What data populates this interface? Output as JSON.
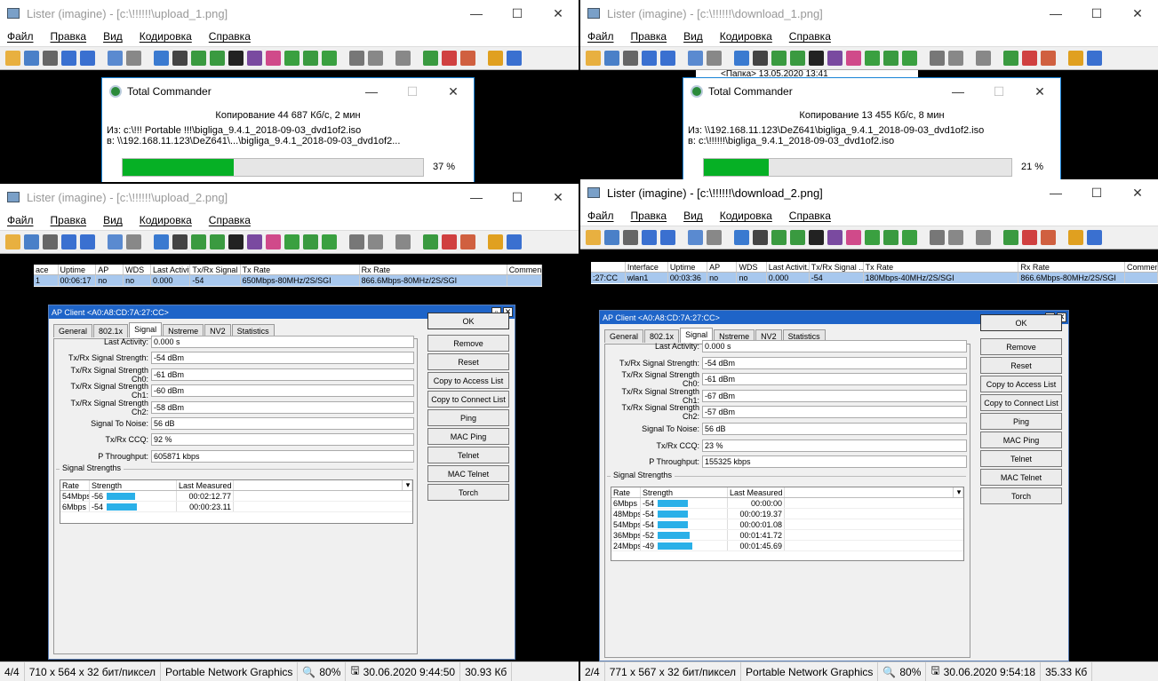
{
  "menu": [
    "Файл",
    "Правка",
    "Вид",
    "Кодировка",
    "Справка"
  ],
  "windows": {
    "w1": {
      "title": "Lister (imagine) - [c:\\!!!!!!\\upload_1.png]"
    },
    "w2": {
      "title": "Lister (imagine) - [c:\\!!!!!!\\download_1.png]"
    },
    "w3": {
      "title": "Lister (imagine) - [c:\\!!!!!!\\upload_2.png]"
    },
    "w4": {
      "title": "Lister (imagine) - [c:\\!!!!!!\\download_2.png]"
    }
  },
  "copy1": {
    "title": "Total Commander",
    "status": "Копирование 44 687 Кб/с, 2 мин",
    "from": "Из:  c:\\!!! Portable !!!\\bigliga_9.4.1_2018-09-03_dvd1of2.iso",
    "to": "в:  \\\\192.168.11.123\\DeZ641\\...\\bigliga_9.4.1_2018-09-03_dvd1of2...",
    "percent_text": "37 %",
    "progress": 0.37
  },
  "copy2": {
    "title": "Total Commander",
    "status": "Копирование 13 455 Кб/с, 8 мин",
    "from": "Из:  \\\\192.168.11.123\\DeZ641\\bigliga_9.4.1_2018-09-03_dvd1of2.iso",
    "to": "в:  c:\\!!!!!!\\bigliga_9.4.1_2018-09-03_dvd1of2.iso",
    "percent_text": "21 %",
    "progress": 0.21,
    "folder_text": "<Папка> 13.05.2020 13:41"
  },
  "table_up": {
    "headers": [
      "ace",
      "Uptime",
      "AP",
      "WDS",
      "Last Activit...",
      "Tx/Rx Signal ...",
      "Tx Rate",
      "Rx Rate",
      "Comment"
    ],
    "row": [
      "1",
      "00:06:17",
      "no",
      "no",
      "0.000",
      "-54",
      "650Mbps-80MHz/2S/SGI",
      "866.6Mbps-80MHz/2S/SGI",
      ""
    ]
  },
  "table_down": {
    "headers": [
      "",
      "Interface",
      "Uptime",
      "AP",
      "WDS",
      "Last Activit...",
      "Tx/Rx Signal ...",
      "Tx Rate",
      "Rx Rate",
      "Comment"
    ],
    "row": [
      ":27:CC",
      "wlan1",
      "00:03:36",
      "no",
      "no",
      "0.000",
      "-54",
      "180Mbps-40MHz/2S/SGI",
      "866.6Mbps-80MHz/2S/SGI",
      ""
    ]
  },
  "dlg_up": {
    "title": "AP Client <A0:A8:CD:7A:27:CC>",
    "tabs": [
      "General",
      "802.1x",
      "Signal",
      "Nstreme",
      "NV2",
      "Statistics"
    ],
    "fields": [
      [
        "Last Activity:",
        "0.000 s"
      ],
      [
        "Tx/Rx Signal Strength:",
        "-54 dBm"
      ],
      [
        "Tx/Rx Signal Strength Ch0:",
        "-61 dBm"
      ],
      [
        "Tx/Rx Signal Strength Ch1:",
        "-60 dBm"
      ],
      [
        "Tx/Rx Signal Strength Ch2:",
        "-58 dBm"
      ],
      [
        "Signal To Noise:",
        "56 dB"
      ],
      [
        "Tx/Rx CCQ:",
        "92 %"
      ],
      [
        "P Throughput:",
        "605871 kbps"
      ]
    ],
    "buttons": [
      "OK",
      "Remove",
      "Reset",
      "Copy to Access List",
      "Copy to Connect List",
      "Ping",
      "MAC Ping",
      "Telnet",
      "MAC Telnet",
      "Torch"
    ],
    "group": "Signal Strengths",
    "ss_headers": [
      "Rate",
      "Strength",
      "Last Measured"
    ],
    "ss_rows": [
      {
        "rate": "54Mbps",
        "strength": "-56",
        "time": "00:02:12.77"
      },
      {
        "rate": "6Mbps",
        "strength": "-54",
        "time": "00:00:23.11"
      }
    ]
  },
  "dlg_down": {
    "title": "AP Client <A0:A8:CD:7A:27:CC>",
    "tabs": [
      "General",
      "802.1x",
      "Signal",
      "Nstreme",
      "NV2",
      "Statistics"
    ],
    "fields": [
      [
        "Last Activity:",
        "0.000 s"
      ],
      [
        "Tx/Rx Signal Strength:",
        "-54 dBm"
      ],
      [
        "Tx/Rx Signal Strength Ch0:",
        "-61 dBm"
      ],
      [
        "Tx/Rx Signal Strength Ch1:",
        "-67 dBm"
      ],
      [
        "Tx/Rx Signal Strength Ch2:",
        "-57 dBm"
      ],
      [
        "Signal To Noise:",
        "56 dB"
      ],
      [
        "Tx/Rx CCQ:",
        "23 %"
      ],
      [
        "P Throughput:",
        "155325 kbps"
      ]
    ],
    "buttons": [
      "OK",
      "Remove",
      "Reset",
      "Copy to Access List",
      "Copy to Connect List",
      "Ping",
      "MAC Ping",
      "Telnet",
      "MAC Telnet",
      "Torch"
    ],
    "group": "Signal Strengths",
    "ss_headers": [
      "Rate",
      "Strength",
      "Last Measured"
    ],
    "ss_rows": [
      {
        "rate": "6Mbps",
        "strength": "-54",
        "time": "00:00:00"
      },
      {
        "rate": "48Mbps",
        "strength": "-54",
        "time": "00:00:19.37"
      },
      {
        "rate": "54Mbps",
        "strength": "-54",
        "time": "00:00:01.08"
      },
      {
        "rate": "36Mbps",
        "strength": "-52",
        "time": "00:01:41.72"
      },
      {
        "rate": "24Mbps",
        "strength": "-49",
        "time": "00:01:45.69"
      }
    ]
  },
  "status_left": {
    "page": "4/4",
    "dims": "710 x 564 x 32 бит/пиксел",
    "format": "Portable Network Graphics",
    "zoom": "80%",
    "date": "30.06.2020 9:44:50",
    "size": "30.93 Кб"
  },
  "status_right": {
    "page": "2/4",
    "dims": "771 x 567 x 32 бит/пиксел",
    "format": "Portable Network Graphics",
    "zoom": "80%",
    "date": "30.06.2020 9:54:18",
    "size": "35.33 Кб"
  },
  "colors": {
    "accent": "#1e64c8",
    "progress": "#06b025",
    "bar": "#2ab0e8"
  }
}
